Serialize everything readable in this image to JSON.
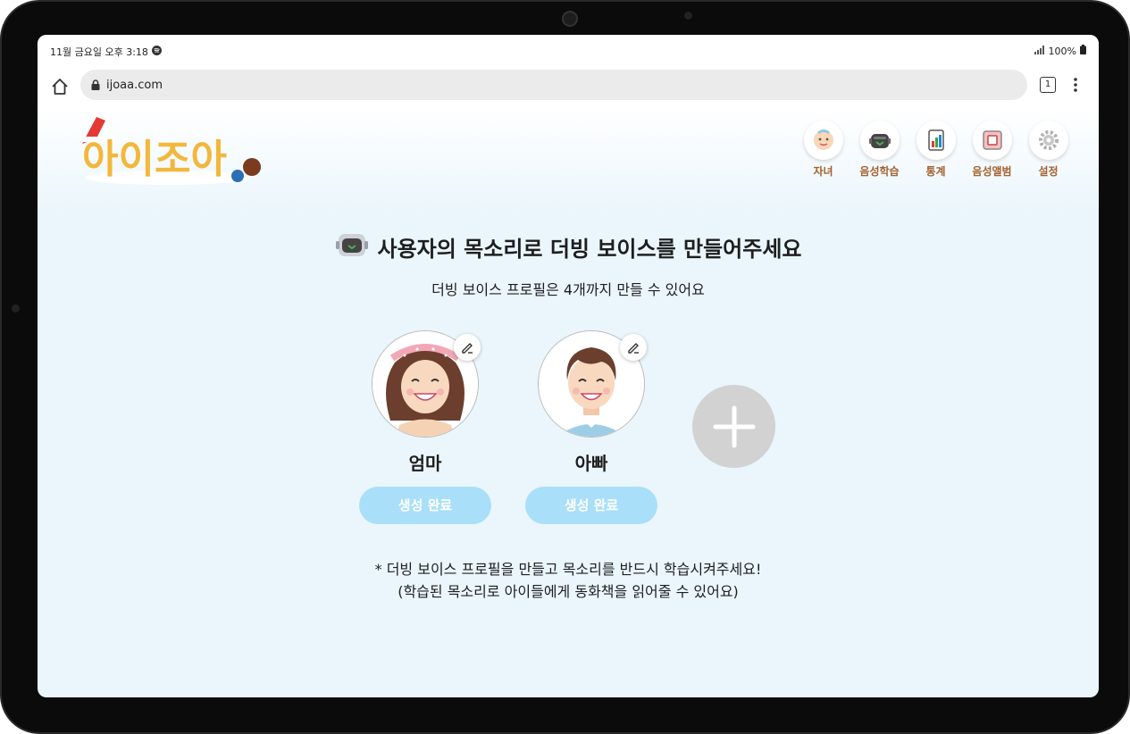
{
  "statusbar": {
    "time": "11월 금요일 오후 3:18",
    "battery": "100%"
  },
  "browser": {
    "url": "ijoaa.com",
    "tab_count": "1"
  },
  "logo": {
    "text": "아이조아"
  },
  "nav": [
    {
      "label": "자녀",
      "icon": "baby-icon"
    },
    {
      "label": "음성학습",
      "icon": "robot-icon"
    },
    {
      "label": "통계",
      "icon": "chart-icon"
    },
    {
      "label": "음성앨범",
      "icon": "album-icon"
    },
    {
      "label": "설정",
      "icon": "gear-icon"
    }
  ],
  "main": {
    "title": "사용자의 목소리로 더빙 보이스를 만들어주세요",
    "subtitle": "더빙 보이스 프로필은 4개까지 만들 수 있어요"
  },
  "profiles": [
    {
      "name": "엄마",
      "status": "생성 완료"
    },
    {
      "name": "아빠",
      "status": "생성 완료"
    }
  ],
  "notice": {
    "line1": "* 더빙 보이스 프로필을 만들고 목소리를 반드시 학습시켜주세요!",
    "line2": "(학습된 목소리로 아이들에게 동화책을 읽어줄 수 있어요)"
  },
  "colors": {
    "background": "#eaf6fc",
    "button": "#a9dff8",
    "nav_label": "#a4612f",
    "add_button": "#d2d2d2"
  }
}
